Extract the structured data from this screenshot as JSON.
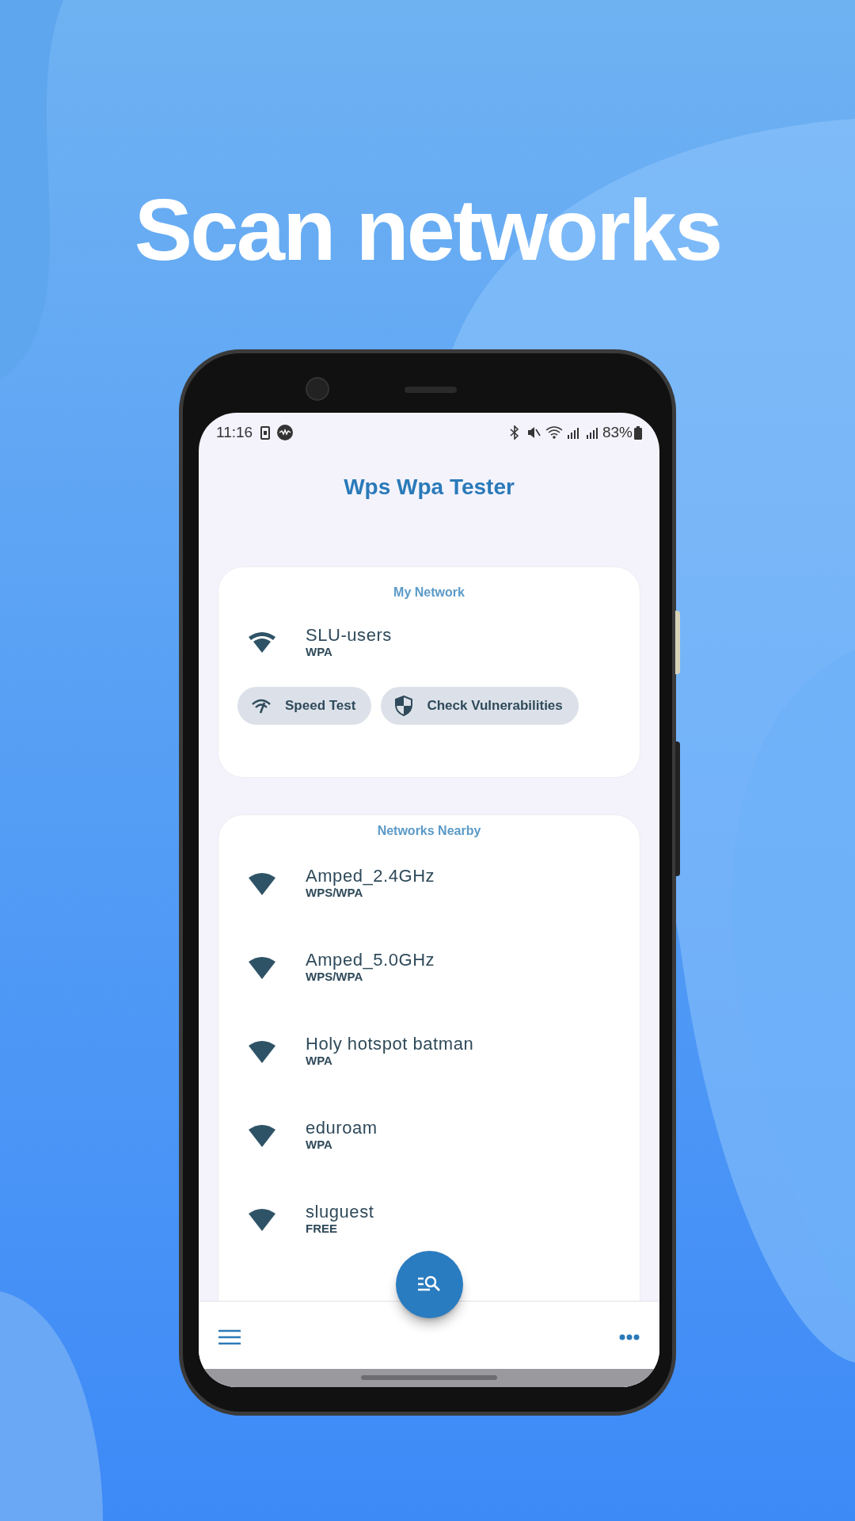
{
  "headline": "Scan networks",
  "status_bar": {
    "time": "11:16",
    "battery": "83%"
  },
  "app_title": "Wps Wpa Tester",
  "my_network": {
    "header": "My Network",
    "name": "SLU-users",
    "security": "WPA",
    "buttons": [
      {
        "label": "Speed Test",
        "kind": "speed"
      },
      {
        "label": "Check Vulnerabilities",
        "kind": "shield"
      }
    ]
  },
  "nearby": {
    "header": "Networks Nearby",
    "networks": [
      {
        "name": "Amped_2.4GHz",
        "security": "WPS/WPA"
      },
      {
        "name": "Amped_5.0GHz",
        "security": "WPS/WPA"
      },
      {
        "name": "Holy hotspot batman",
        "security": "WPA"
      },
      {
        "name": "eduroam",
        "security": "WPA"
      },
      {
        "name": "sluguest",
        "security": "FREE"
      }
    ]
  }
}
